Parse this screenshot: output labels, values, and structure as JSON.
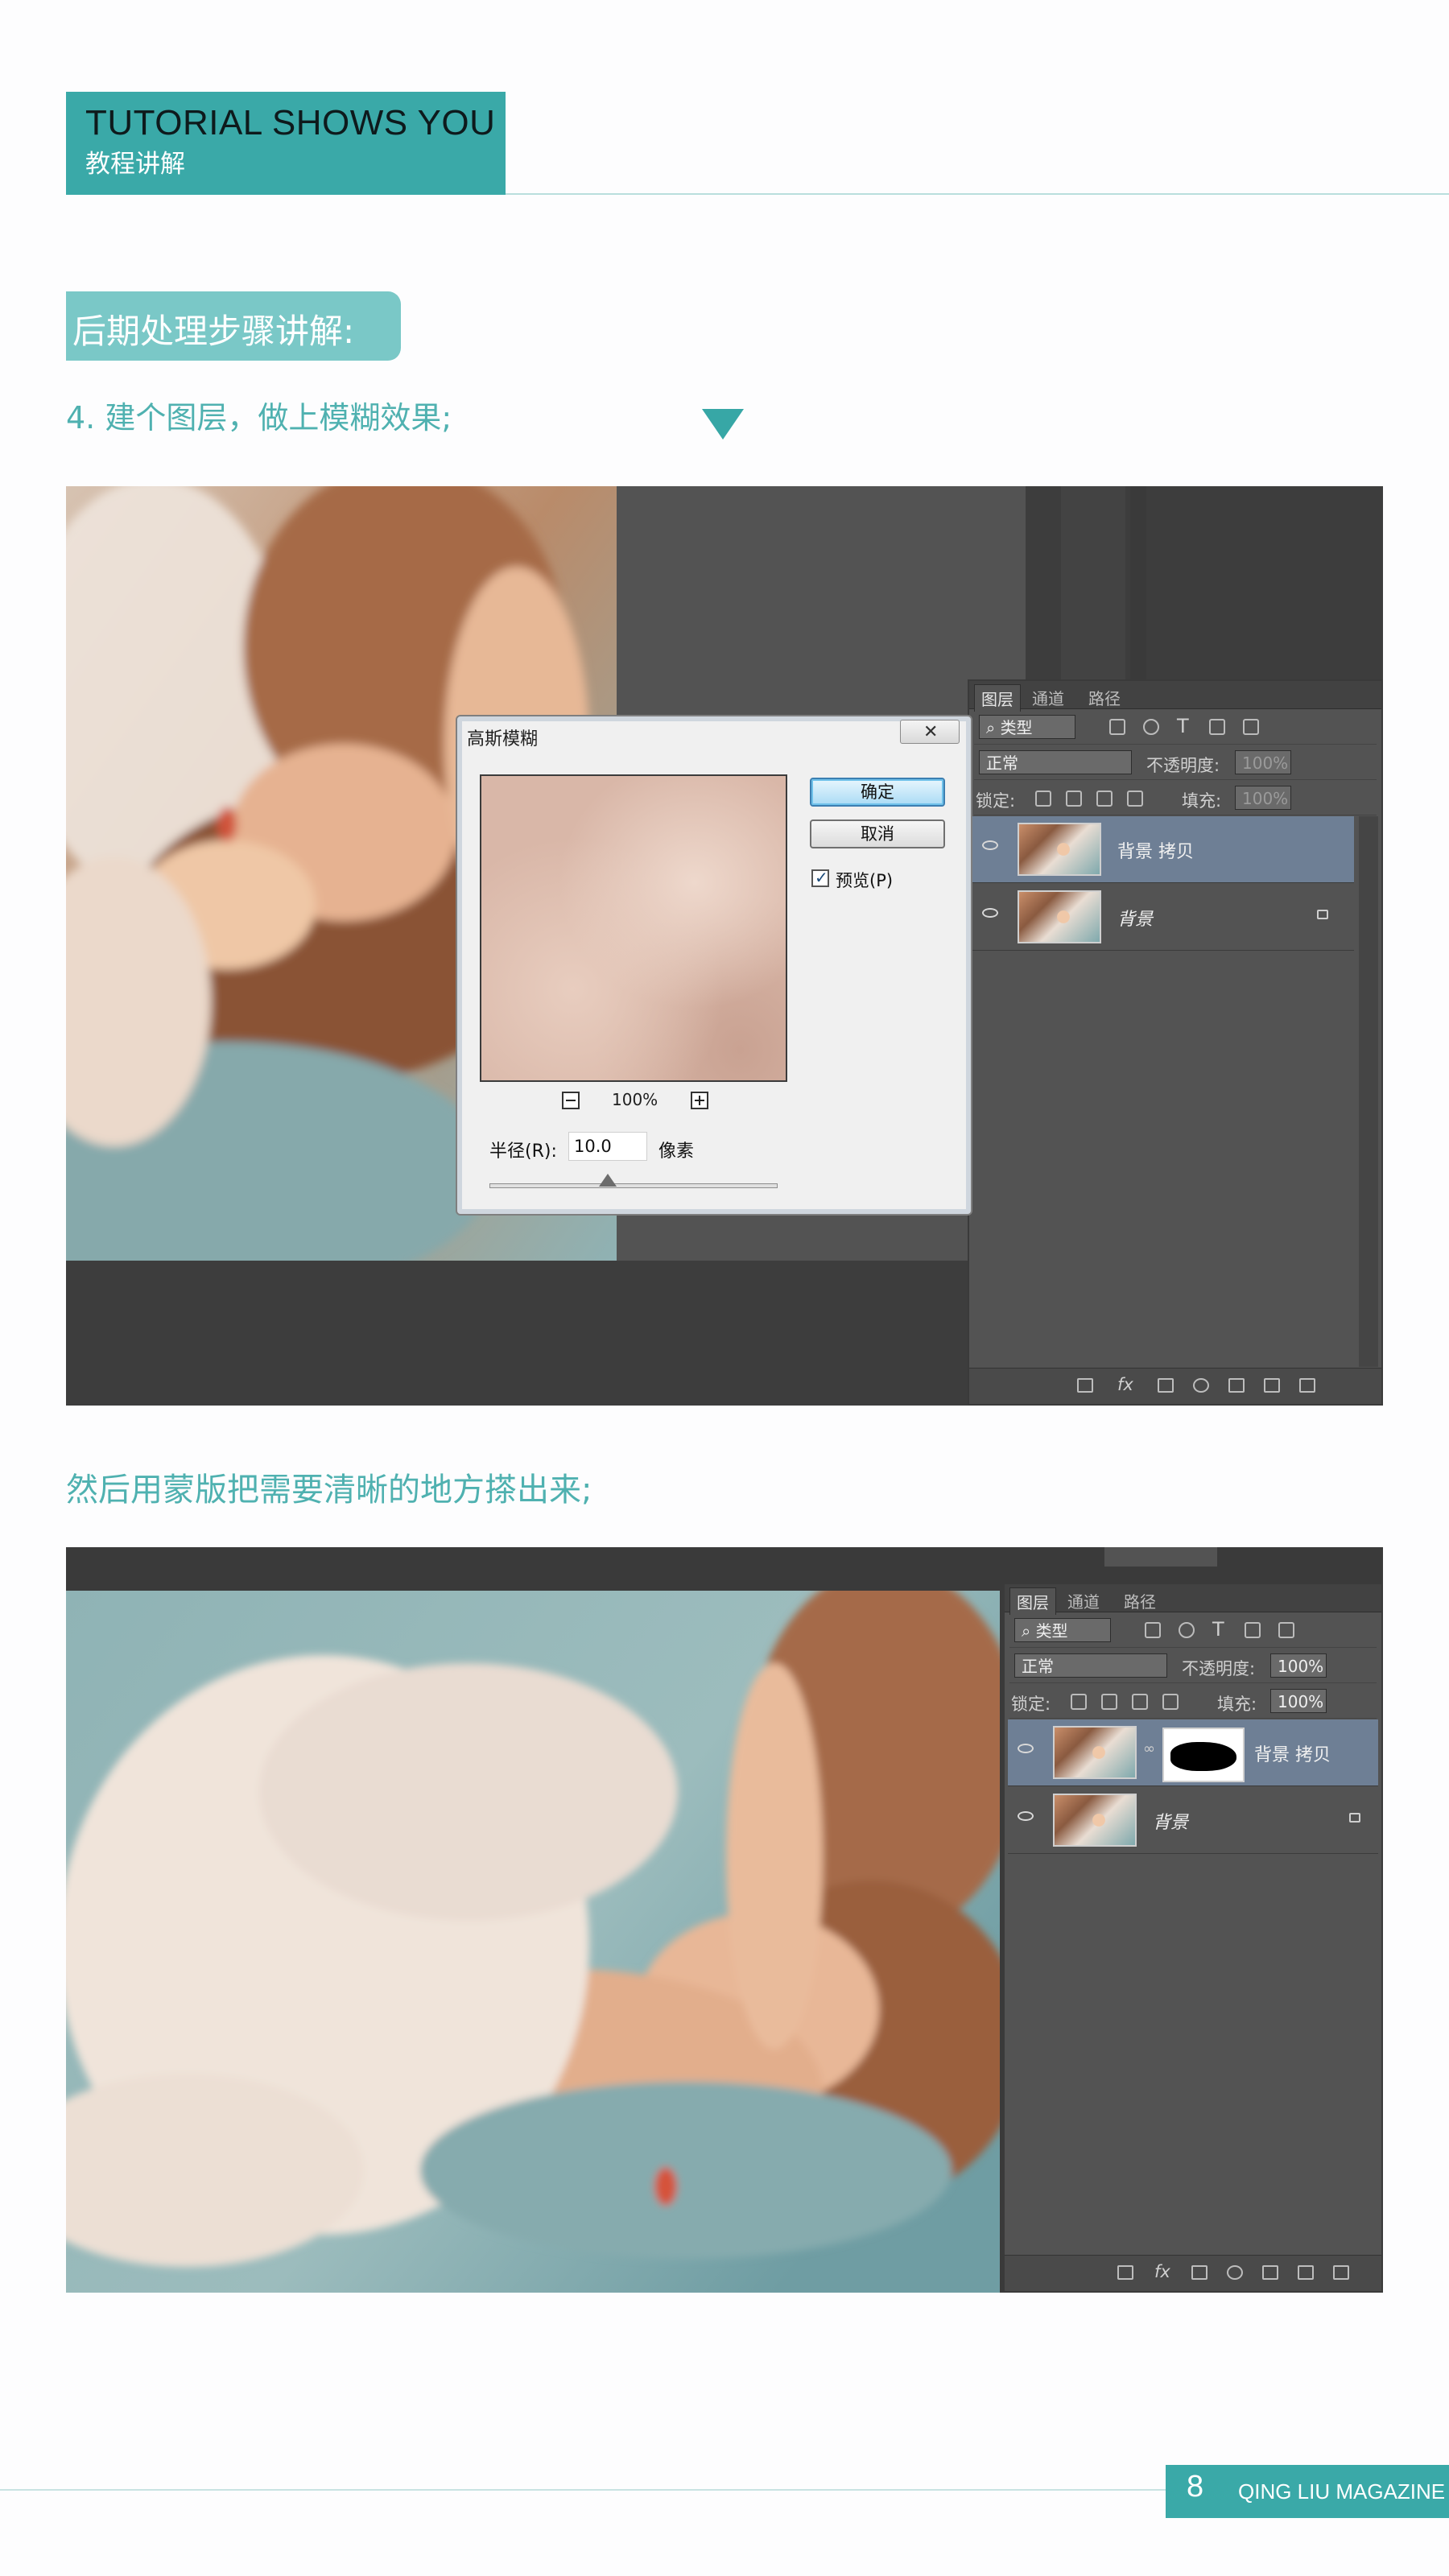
{
  "header": {
    "title_en": "TUTORIAL SHOWS YOU",
    "title_cn": "教程讲解"
  },
  "section": {
    "pill": "后期处理步骤讲解:"
  },
  "steps": {
    "step4": "4. 建个图层，做上模糊效果;",
    "mask_step": "然后用蒙版把需要清晰的地方搽出来;"
  },
  "ps": {
    "tabs": [
      "图层",
      "通道",
      "路径"
    ],
    "filter_kind": "类型",
    "blend_mode": "正常",
    "opacity_label": "不透明度:",
    "opacity_value": "100%",
    "lock_label": "锁定:",
    "fill_label": "填充:",
    "fill_value": "100%",
    "layers": [
      {
        "name": "背景 拷贝",
        "selected": true
      },
      {
        "name": "背景",
        "selected": false,
        "locked": true
      }
    ]
  },
  "dialog": {
    "title": "高斯模糊",
    "ok": "确定",
    "cancel": "取消",
    "preview_label": "预览(P)",
    "preview_checked": true,
    "zoom": "100%",
    "radius_label": "半径(R):",
    "radius_value": "10.0",
    "radius_unit": "像素"
  },
  "footer": {
    "page_number": "8",
    "magazine": "QING LIU MAGAZINE"
  },
  "colors": {
    "accent": "#3aa9a8",
    "accent_light": "#7ac8c7",
    "text_teal": "#4fb1b0",
    "ps_panel": "#535353",
    "ps_selected_layer": "#6e7f95"
  }
}
